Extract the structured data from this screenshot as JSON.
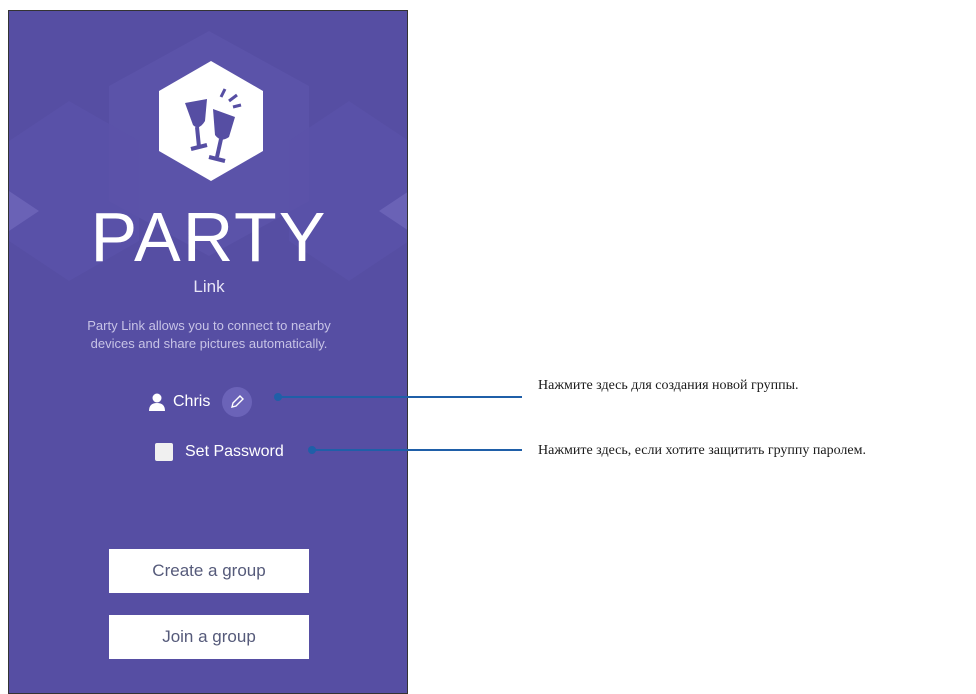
{
  "app": {
    "title_large": "PARTY",
    "title_small": "Link",
    "description_lines": [
      "Party Link allows you to connect to nearby",
      "devices and share pictures automatically."
    ]
  },
  "user": {
    "name": "Chris"
  },
  "password": {
    "label": "Set Password",
    "checked": false
  },
  "buttons": {
    "create": "Create a group",
    "join": "Join a group"
  },
  "callouts": {
    "edit_name": "Нажмите здесь для создания новой группы.",
    "set_password": "Нажмите здесь, если хотите защитить группу паролем."
  },
  "colors": {
    "background": "#564ea3",
    "accent_line": "#1f5fa8",
    "button_bg": "#ffffff",
    "button_text": "#555a7a"
  },
  "icons": {
    "logo": "party-glasses-icon",
    "user": "user-icon",
    "edit": "pencil-icon",
    "checkbox": "checkbox-unchecked"
  }
}
